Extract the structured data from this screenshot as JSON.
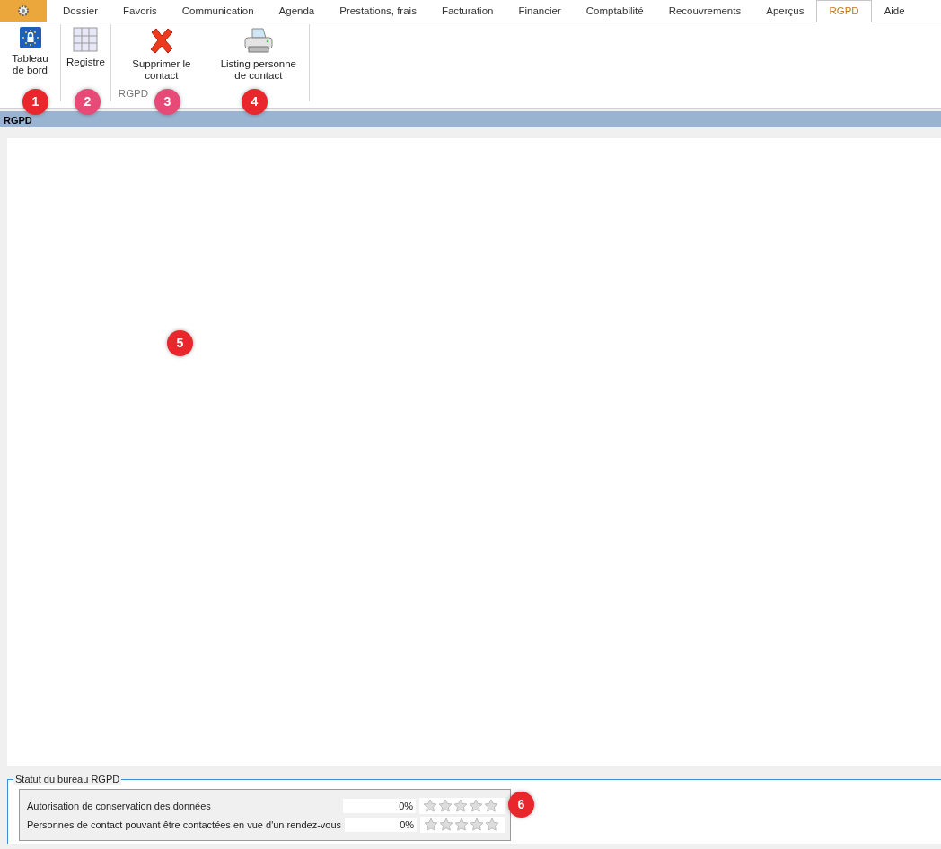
{
  "app_button": {
    "kind": "gear"
  },
  "tabs": [
    {
      "label": "Dossier",
      "selected": false
    },
    {
      "label": "Favoris",
      "selected": false
    },
    {
      "label": "Communication",
      "selected": false
    },
    {
      "label": "Agenda",
      "selected": false
    },
    {
      "label": "Prestations, frais",
      "selected": false
    },
    {
      "label": "Facturation",
      "selected": false
    },
    {
      "label": "Financier",
      "selected": false
    },
    {
      "label": "Comptabilité",
      "selected": false
    },
    {
      "label": "Recouvrements",
      "selected": false
    },
    {
      "label": "Aperçus",
      "selected": false
    },
    {
      "label": "RGPD",
      "selected": true
    },
    {
      "label": "Aide",
      "selected": false
    }
  ],
  "ribbon": {
    "groups": [
      {
        "buttons": [
          {
            "label": "Tableau de bord",
            "kind": "lock"
          }
        ]
      },
      {
        "buttons": [
          {
            "label": "Registre",
            "kind": "grid"
          }
        ]
      },
      {
        "label": "RGPD",
        "buttons": [
          {
            "label": "Supprimer le contact",
            "kind": "delete"
          },
          {
            "label": "Listing personne de contact",
            "kind": "printer"
          }
        ]
      }
    ]
  },
  "panel": {
    "title": "RGPD"
  },
  "status": {
    "title": "Statut du bureau RGPD",
    "rows": [
      {
        "label": "Autorisation de conservation des données",
        "value": "0%",
        "stars": 0
      },
      {
        "label": "Personnes de contact pouvant être contactées en vue d'un rendez-vous",
        "value": "0%",
        "stars": 0
      }
    ]
  },
  "callouts": [
    {
      "label": "1",
      "color": "#e8262c"
    },
    {
      "label": "2",
      "color": "#e84a78"
    },
    {
      "label": "3",
      "color": "#e84a78"
    },
    {
      "label": "4",
      "color": "#e8262c"
    },
    {
      "label": "5",
      "color": "#e8262c"
    },
    {
      "label": "6",
      "color": "#e8262c"
    }
  ]
}
